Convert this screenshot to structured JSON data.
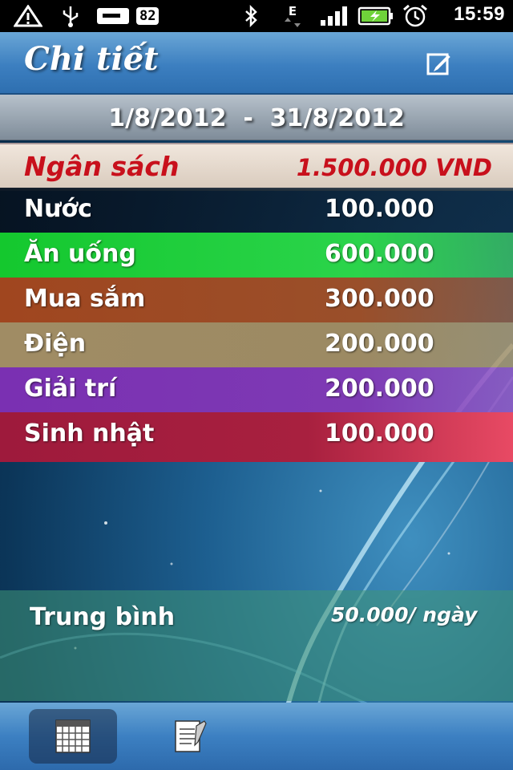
{
  "status_bar": {
    "notification_count": "82",
    "network_type": "E",
    "time": "15:59"
  },
  "header": {
    "title": "Chi tiết"
  },
  "period": {
    "date_range": "1/8/2012  -  31/8/2012"
  },
  "budget": {
    "label": "Ngân sách",
    "value": "1.500.000 VND"
  },
  "categories": [
    {
      "label": "Nước",
      "value": "100.000",
      "color": "#0a1a2a"
    },
    {
      "label": "Ăn uống",
      "value": "600.000",
      "color": "#1fb83a"
    },
    {
      "label": "Mua sắm",
      "value": "300.000",
      "color": "#9a4a22"
    },
    {
      "label": "Điện",
      "value": "200.000",
      "color": "#9c8a63"
    },
    {
      "label": "Giải trí",
      "value": "200.000",
      "color": "#7a36b0"
    },
    {
      "label": "Sinh nhật",
      "value": "100.000",
      "color": "#a11d3e"
    }
  ],
  "average": {
    "label": "Trung bình",
    "value": "50.000/ ngày"
  },
  "tabs": [
    {
      "icon": "calendar-icon",
      "active": true
    },
    {
      "icon": "notepad-icon",
      "active": false
    }
  ]
}
